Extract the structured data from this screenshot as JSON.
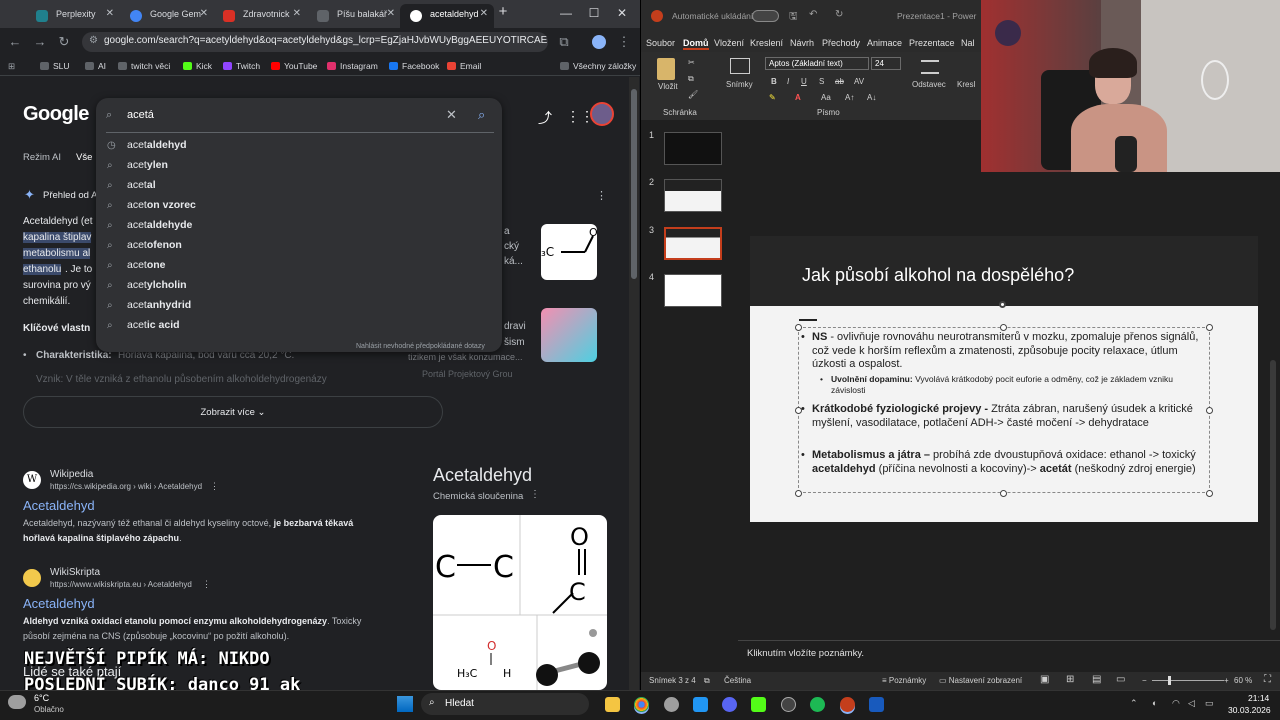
{
  "chrome": {
    "tabs": [
      "Perplexity",
      "Google Gem",
      "Zdravotnick",
      "Píšu balakář",
      "acetaldehyd"
    ],
    "url": "google.com/search?q=acetyldehyd&oq=acetyldehyd&gs_lcrp=EgZjaHJvbWUyBggAEEUYOTIRCAE...",
    "bookmarks": [
      "SLU",
      "AI",
      "twitch věci",
      "Kick",
      "Twitch",
      "YouTube",
      "Instagram",
      "Facebook",
      "Email",
      "Všechny záložky"
    ],
    "bookmark_colors": [
      "#5f6368",
      "#5f6368",
      "#5f6368",
      "#53fc18",
      "#9146ff",
      "#ff0000",
      "#e1306c",
      "#1877f2",
      "#ea4335",
      "#5f6368"
    ]
  },
  "google": {
    "logo": "Google",
    "query": "acetá",
    "suggestions": [
      {
        "pre": "acet",
        "bold": "aldehyd"
      },
      {
        "pre": "acet",
        "bold": "ylen"
      },
      {
        "pre": "acet",
        "bold": "al"
      },
      {
        "pre": "acet",
        "bold": "on vzorec"
      },
      {
        "pre": "acet",
        "bold": "aldehyde"
      },
      {
        "pre": "acet",
        "bold": "ofenon"
      },
      {
        "pre": "acet",
        "bold": "one"
      },
      {
        "pre": "acet",
        "bold": "ylcholin"
      },
      {
        "pre": "acet",
        "bold": "anhydrid"
      },
      {
        "pre": "acet",
        "bold": "ic acid"
      }
    ],
    "report": "Nahlásit nevhodné předpokládané dotazy",
    "tab_ai": "Režim AI",
    "tab_all": "Vše",
    "overview": "Přehled od A",
    "ai_text": [
      "Acetaldehyd (et",
      "kapalina štiplav",
      "metabolismu al",
      "ethanolu",
      ". Je to",
      "surovina pro vý",
      "chemikálií."
    ],
    "key_props": "Klíčové vlastn",
    "char_label": "Charakteristika:",
    "char_text": "Hořlavá kapalina, bod varu cca 20,2 °C.",
    "origin": "Vznik: V těle vzniká z ethanolu působením alkoholdehydrogenázy",
    "side_frag": [
      "a",
      "cký",
      "ká..."
    ],
    "side_frag2": [
      "dravi",
      "šism",
      "tizikem je však konzumace..."
    ],
    "portal": "Portál Projektový Grou",
    "more": "Zobrazit více",
    "results": [
      {
        "site": "Wikipedia",
        "url": "https://cs.wikipedia.org › wiki › Acetaldehyd",
        "title": "Acetaldehyd",
        "snippet": "Acetaldehyd, nazývaný též ethanal či aldehyd kyseliny octové,",
        "snippet_bold": " je bezbarvá těkavá",
        "snippet2": "hořlavá kapalina štiplavého zápachu",
        "snippet2_end": "."
      },
      {
        "site": "WikiSkripta",
        "url": "https://www.wikiskripta.eu › Acetaldehyd",
        "title": "Acetaldehyd",
        "snippet_bold": "Aldehyd vzniká oxidací etanolu pomocí enzymu alkoholdehydrogenázy",
        "snippet": ". Toxicky",
        "snippet2": "působí zejména na CNS (způsobuje „kocovinu“ po požití alkoholu)."
      }
    ],
    "kp_title": "Acetaldehyd",
    "kp_sub": "Chemická sloučenina",
    "people_ask": "Lidé se také ptají"
  },
  "overlay": {
    "line1": "NEJVĚTŠÍ PIPÍK MÁ: NIKDO",
    "line2": "POSLEDNÍ SUBÍK: danco_91_ak"
  },
  "ppt": {
    "autosave": "Automatické ukládání",
    "doc": "Prezentace1 - Power",
    "ribbon_tabs": [
      "Soubor",
      "Domů",
      "Vložení",
      "Kreslení",
      "Návrh",
      "Přechody",
      "Animace",
      "Prezentace",
      "Nal"
    ],
    "font": "Aptos (Základní text)",
    "size": "24",
    "groups": {
      "paste": "Vložit",
      "clipboard": "Schránka",
      "slides": "Snímky",
      "font": "Písmo",
      "para": "Odstavec",
      "draw": "Kresl"
    },
    "slide_numbers": [
      "1",
      "2",
      "3",
      "4"
    ],
    "slide_title": "Jak působí alkohol na dospělého?",
    "bullets": [
      {
        "bold": "NS",
        "text": " - ovlivňuje rovnováhu neurotransmiterů v mozku, zpomaluje přenos signálů, což vede k horším reflexům a zmatenosti, způsobuje pocity relaxace, útlum úzkosti a ospalost."
      },
      {
        "bold": "Krátkodobé fyziologické projevy -",
        "text": " Ztráta zábran, narušený úsudek a kritické myšlení, vasodilatace, potlačení ADH-> časté močení -> dehydratace"
      }
    ],
    "sub_bullet": {
      "bold": "Uvolnění dopaminu:",
      "text": " Vyvolává krátkodobý pocit euforie a odměny, což je základem vzniku závislosti"
    },
    "bullet3": {
      "bold": "Metabolismus a játra –",
      "text1": " probíhá zde dvoustupňová oxidace: ethanol -> toxický ",
      "bold2": "acetaldehyd",
      "text2": " (příčina nevolnosti a kocoviny)-> ",
      "bold3": "acetát",
      "text3": " (neškodný zdroj energie)"
    },
    "notes": "Kliknutím vložíte poznámky.",
    "status": {
      "slide": "Snímek 3 z 4",
      "lang": "Čeština",
      "notes": "Poznámky",
      "view": "Nastavení zobrazení",
      "zoom": "60 %"
    }
  },
  "taskbar": {
    "weather_temp": "6°C",
    "weather_text": "Oblačno",
    "search": "Hledat",
    "time": "21:14",
    "date": "30.03.2026"
  }
}
